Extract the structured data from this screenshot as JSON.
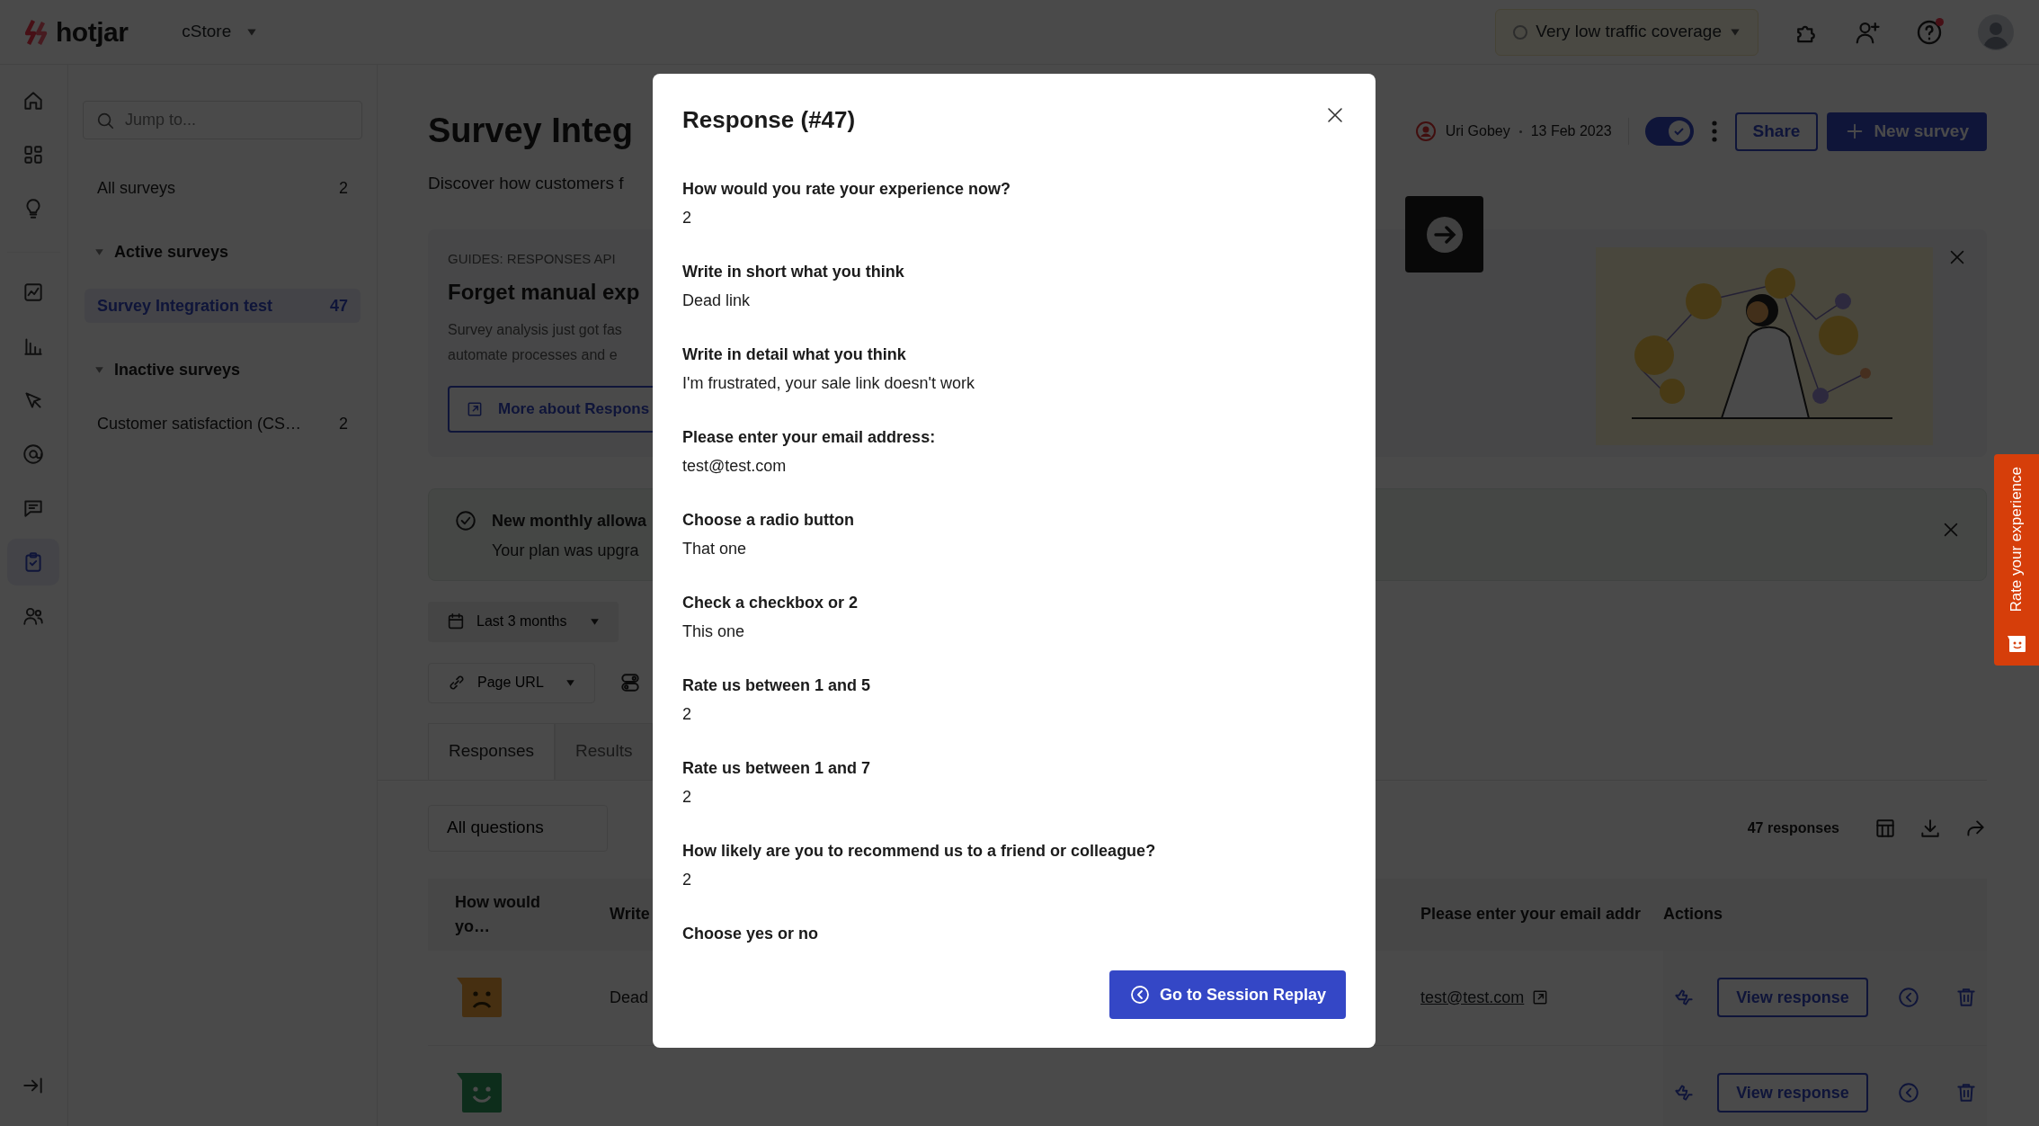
{
  "topbar": {
    "logo": "hotjar",
    "site": "cStore",
    "coverage": "Very low traffic coverage",
    "help_notification": true
  },
  "rail": [
    {
      "selected": false
    },
    {
      "selected": false
    },
    {
      "selected": false
    },
    {
      "selected": false
    },
    {
      "selected": false
    },
    {
      "selected": false
    },
    {
      "selected": false
    },
    {
      "selected": false
    },
    {
      "selected": true
    },
    {
      "selected": false
    }
  ],
  "sidebar": {
    "placeholder": "Jump to...",
    "items": [
      {
        "kind": "link",
        "label": "All surveys",
        "count": "2",
        "selected": false
      },
      {
        "kind": "group",
        "label": "Active surveys",
        "expanded": true
      },
      {
        "kind": "link",
        "label": "Survey Integration test",
        "count": "47",
        "selected": true
      },
      {
        "kind": "group",
        "label": "Inactive surveys",
        "expanded": true
      },
      {
        "kind": "link",
        "label": "Customer satisfaction (CS…",
        "count": "2",
        "selected": false
      }
    ]
  },
  "header": {
    "title": "Survey Integ",
    "subtitle": "Discover how customers f",
    "owner": "Uri Gobey",
    "date": "13 Feb 2023",
    "active": true,
    "share": "Share",
    "new_survey": "New survey"
  },
  "guide": {
    "eyebrow": "GUIDES: RESPONSES API",
    "title": "Forget manual exp",
    "lines": [
      "Survey analysis just got fas",
      "automate processes and e"
    ],
    "button": "More about Respons"
  },
  "notice": {
    "title": "New monthly allowa",
    "text": "Your plan was upgra"
  },
  "filters": {
    "date": "Last 3 months",
    "page": "Page URL"
  },
  "tabs": [
    {
      "label": "Responses",
      "selected": true
    },
    {
      "label": "Results",
      "selected": false
    }
  ],
  "toolbar": {
    "question_filter": "All questions",
    "count": "47 responses"
  },
  "table": {
    "columns": [
      "How would yo…",
      "Write",
      "Please enter your email addr",
      "Actions"
    ],
    "rows": [
      {
        "kind": "sad",
        "write": "Dead",
        "email": "test@test.com",
        "action": "View response"
      },
      {
        "kind": "happy",
        "action": "View response"
      }
    ]
  },
  "modal": {
    "title": "Response (#47)",
    "answers": [
      {
        "question": "How would you rate your experience now?",
        "answer": "2"
      },
      {
        "question": "Write in short what you think",
        "answer": "Dead link"
      },
      {
        "question": "Write in detail what you think",
        "answer": "I'm frustrated, your sale link doesn't work"
      },
      {
        "question": "Please enter your email address:",
        "answer": "test@test.com"
      },
      {
        "question": "Choose a radio button",
        "answer": "That one"
      },
      {
        "question": "Check a checkbox or 2",
        "answer": "This one"
      },
      {
        "question": "Rate us between 1 and 5",
        "answer": "2"
      },
      {
        "question": "Rate us between 1 and 7",
        "answer": "2"
      },
      {
        "question": "How likely are you to recommend us to a friend or colleague?",
        "answer": "2"
      },
      {
        "question": "Choose yes or no"
      }
    ],
    "button": "Go to Session Replay"
  },
  "feedback_tab": "Rate your experience"
}
